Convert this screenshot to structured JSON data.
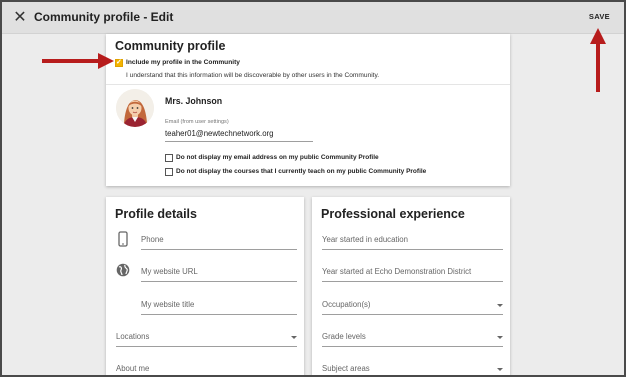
{
  "window": {
    "title": "Community profile - Edit",
    "save_label": "SAVE"
  },
  "community": {
    "title": "Community profile",
    "include_label": "Include my profile in the Community",
    "include_checked": true,
    "include_description": "I understand that this information will be discoverable by other users in the Community.",
    "user_name": "Mrs. Johnson",
    "email_label": "Email (from user settings)",
    "email_value": "teaher01@newtechnetwork.org",
    "hide_email_label": "Do not display my email address on my public Community Profile",
    "hide_courses_label": "Do not display the courses that I currently teach on my public Community Profile"
  },
  "profile_details": {
    "title": "Profile details",
    "phone_placeholder": "Phone",
    "website_url_placeholder": "My website URL",
    "website_title_placeholder": "My website title",
    "locations_label": "Locations",
    "about_me_label": "About me"
  },
  "professional_experience": {
    "title": "Professional experience",
    "year_education_placeholder": "Year started in education",
    "year_district_placeholder": "Year started at Echo Demonstration District",
    "occupation_label": "Occupation(s)",
    "grade_levels_label": "Grade levels",
    "subject_areas_label": "Subject areas"
  },
  "colors": {
    "accent": "#f4b400",
    "annotation_arrow": "#b71c1c"
  }
}
